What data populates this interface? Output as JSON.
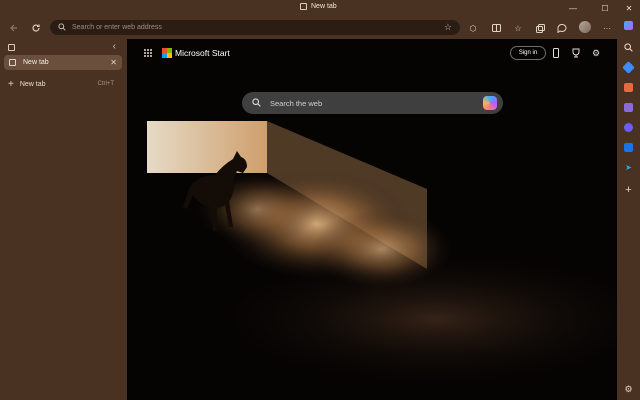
{
  "window": {
    "title": "New tab",
    "controls": {
      "minimize": "—",
      "maximize": "☐",
      "close": "✕"
    }
  },
  "toolbar": {
    "back_icon": "arrow-left-icon",
    "refresh_icon": "refresh-icon",
    "address_placeholder": "Search or enter web address",
    "right_icons": [
      "extensions-icon",
      "split-screen-icon",
      "favorites-icon",
      "collections-icon",
      "copilot-icon",
      "profile-icon",
      "more-icon"
    ]
  },
  "vertical_tabs": {
    "tabs": [
      {
        "label": "New tab",
        "active": true
      }
    ],
    "new_tab": {
      "label": "New tab",
      "shortcut": "Ctrl+T"
    }
  },
  "newtab_page": {
    "brand": "Microsoft Start",
    "sign_in": "Sign in",
    "search_placeholder": "Search the web",
    "top_icons": [
      "phone-icon",
      "rewards-icon",
      "settings-icon"
    ]
  },
  "right_sidebar": {
    "items": [
      "search-icon",
      "shopping-icon",
      "tools-icon",
      "games-icon",
      "copilot-app-icon",
      "outlook-icon",
      "telegram-icon",
      "add-icon",
      "settings-icon"
    ],
    "colors": {
      "shopping": "#3a8cff",
      "tools": "#e86a3a",
      "games": "#8a6ad8",
      "copilot": "#6a5cff",
      "outlook": "#1a73e8",
      "telegram": "#29a9eb"
    }
  },
  "colors": {
    "chrome": "#4a3222",
    "address_bg": "#2c1d14",
    "active_tab": "#6a4f3d"
  }
}
